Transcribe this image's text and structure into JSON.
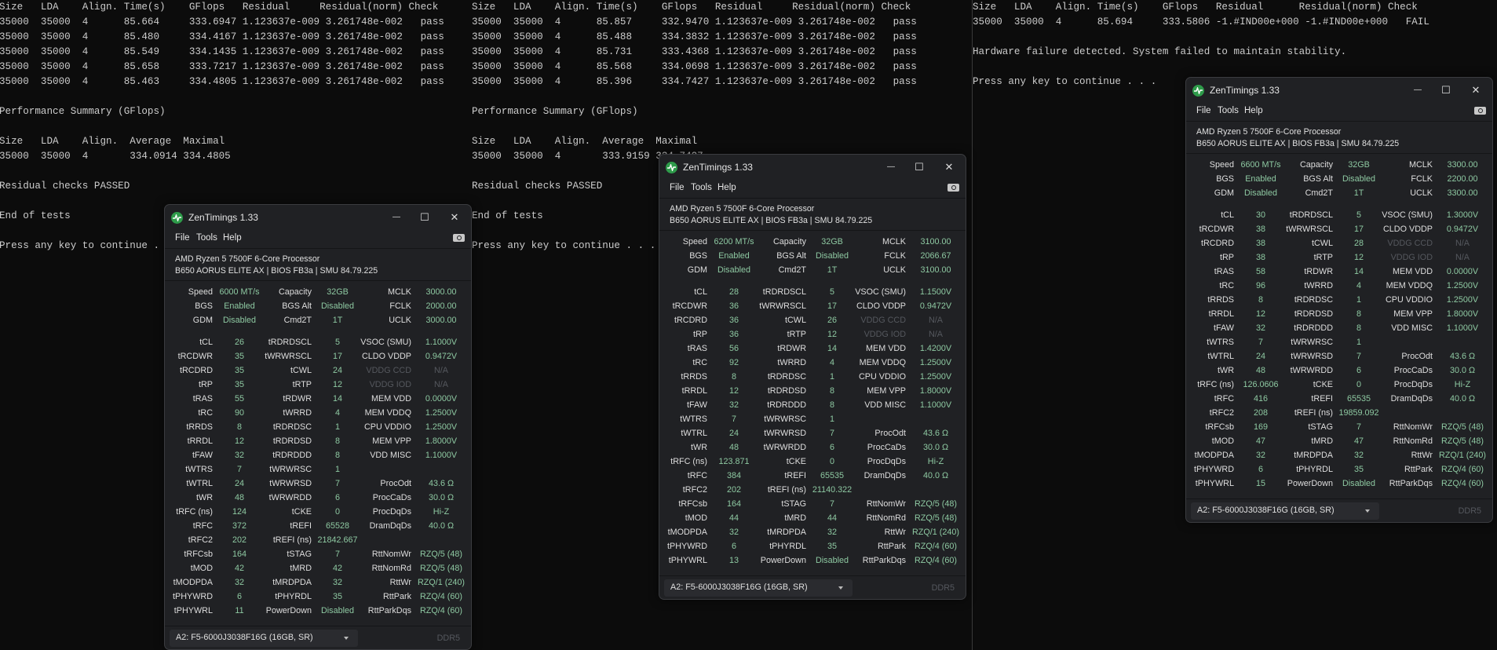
{
  "consoles": [
    {
      "lines": [
        "Size   LDA    Align. Time(s)    GFlops   Residual     Residual(norm) Check",
        "35000  35000  4      85.664     333.6947 1.123637e-009 3.261748e-002   pass",
        "35000  35000  4      85.480     334.4167 1.123637e-009 3.261748e-002   pass",
        "35000  35000  4      85.549     334.1435 1.123637e-009 3.261748e-002   pass",
        "35000  35000  4      85.658     333.7217 1.123637e-009 3.261748e-002   pass",
        "35000  35000  4      85.463     334.4805 1.123637e-009 3.261748e-002   pass",
        "",
        "Performance Summary (GFlops)",
        "",
        "Size   LDA    Align.  Average  Maximal",
        "35000  35000  4       334.0914 334.4805",
        "",
        "Residual checks PASSED",
        "",
        "End of tests",
        "",
        "Press any key to continue . . ."
      ]
    },
    {
      "lines": [
        "Size   LDA    Align. Time(s)    GFlops   Residual     Residual(norm) Check",
        "35000  35000  4      85.857     332.9470 1.123637e-009 3.261748e-002   pass",
        "35000  35000  4      85.488     334.3832 1.123637e-009 3.261748e-002   pass",
        "35000  35000  4      85.731     333.4368 1.123637e-009 3.261748e-002   pass",
        "35000  35000  4      85.568     334.0698 1.123637e-009 3.261748e-002   pass",
        "35000  35000  4      85.396     334.7427 1.123637e-009 3.261748e-002   pass",
        "",
        "Performance Summary (GFlops)",
        "",
        "Size   LDA    Align.  Average  Maximal",
        "35000  35000  4       333.9159 334.7427",
        "",
        "Residual checks PASSED",
        "",
        "End of tests",
        "",
        "Press any key to continue . . ."
      ]
    },
    {
      "lines": [
        "Size   LDA    Align. Time(s)    GFlops   Residual      Residual(norm) Check",
        "35000  35000  4      85.694     333.5806 -1.#IND00e+000 -1.#IND00e+000   FAIL",
        "",
        "Hardware failure detected. System failed to maintain stability.",
        "",
        "Press any key to continue . . ."
      ]
    }
  ],
  "zentimings": {
    "colors": {
      "background": "#202124",
      "value": "#8ec9a2",
      "label": "#dedede",
      "dimmed": "#55585e",
      "logo": "#2e9b4a"
    },
    "icons": {
      "logo": "pulse-icon",
      "minimize": "minimize-icon",
      "maximize": "maximize-icon",
      "close": "close-icon",
      "screenshot": "camera-icon",
      "dropdown": "chevron-down-icon"
    },
    "labels": {
      "top": [
        [
          "Speed",
          "Capacity",
          "MCLK"
        ],
        [
          "BGS",
          "BGS Alt",
          "FCLK"
        ],
        [
          "GDM",
          "Cmd2T",
          "UCLK"
        ]
      ],
      "rows": [
        [
          "tCL",
          "tRDRDSCL",
          "VSOC (SMU)"
        ],
        [
          "tRCDWR",
          "tWRWRSCL",
          "CLDO VDDP"
        ],
        [
          "tRCDRD",
          "tCWL",
          "VDDG CCD"
        ],
        [
          "tRP",
          "tRTP",
          "VDDG IOD"
        ],
        [
          "tRAS",
          "tRDWR",
          "MEM VDD"
        ],
        [
          "tRC",
          "tWRRD",
          "MEM VDDQ"
        ],
        [
          "tRRDS",
          "tRDRDSC",
          "CPU VDDIO"
        ],
        [
          "tRRDL",
          "tRDRDSD",
          "MEM VPP"
        ],
        [
          "tFAW",
          "tRDRDDD",
          "VDD MISC"
        ],
        [
          "tWTRS",
          "tWRWRSC",
          ""
        ],
        [
          "tWTRL",
          "tWRWRSD",
          "ProcOdt"
        ],
        [
          "tWR",
          "tWRWRDD",
          "ProcCaDs"
        ],
        [
          "tRFC (ns)",
          "tCKE",
          "ProcDqDs"
        ],
        [
          "tRFC",
          "tREFI",
          "DramDqDs"
        ],
        [
          "tRFC2",
          "tREFI (ns)",
          ""
        ],
        [
          "tRFCsb",
          "tSTAG",
          "RttNomWr"
        ],
        [
          "tMOD",
          "tMRD",
          "RttNomRd"
        ],
        [
          "tMODPDA",
          "tMRDPDA",
          "RttWr"
        ],
        [
          "tPHYWRD",
          "tPHYRDL",
          "RttPark"
        ],
        [
          "tPHYWRL",
          "PowerDown",
          "RttParkDqs"
        ]
      ]
    },
    "windows": [
      {
        "title": "ZenTimings 1.33",
        "menu": [
          "File",
          "Tools",
          "Help"
        ],
        "cpu": "AMD Ryzen 5 7500F 6-Core Processor",
        "board": "B650 AORUS ELITE AX | BIOS FB3a | SMU 84.79.225",
        "top": [
          [
            "6000 MT/s",
            "32GB",
            "3000.00"
          ],
          [
            "Enabled",
            "Disabled",
            "2000.00"
          ],
          [
            "Disabled",
            "1T",
            "3000.00"
          ]
        ],
        "rows": [
          [
            "26",
            "5",
            "1.1000V"
          ],
          [
            "35",
            "17",
            "0.9472V"
          ],
          [
            "35",
            "24",
            "N/A"
          ],
          [
            "35",
            "12",
            "N/A"
          ],
          [
            "55",
            "14",
            "0.0000V"
          ],
          [
            "90",
            "4",
            "1.2500V"
          ],
          [
            "8",
            "1",
            "1.2500V"
          ],
          [
            "12",
            "8",
            "1.8000V"
          ],
          [
            "32",
            "8",
            "1.1000V"
          ],
          [
            "7",
            "1",
            ""
          ],
          [
            "24",
            "7",
            "43.6 Ω"
          ],
          [
            "48",
            "6",
            "30.0 Ω"
          ],
          [
            "124",
            "0",
            "Hi-Z"
          ],
          [
            "372",
            "65528",
            "40.0 Ω"
          ],
          [
            "202",
            "21842.667",
            ""
          ],
          [
            "164",
            "7",
            "RZQ/5 (48)"
          ],
          [
            "42",
            "42",
            "RZQ/5 (48)"
          ],
          [
            "32",
            "32",
            "RZQ/1 (240)"
          ],
          [
            "6",
            "35",
            "RZQ/4 (60)"
          ],
          [
            "11",
            "Disabled",
            "RZQ/4 (60)"
          ]
        ],
        "dimm": "A2: F5-6000J3038F16G (16GB, SR)",
        "memtype": "DDR5"
      },
      {
        "title": "ZenTimings 1.33",
        "menu": [
          "File",
          "Tools",
          "Help"
        ],
        "cpu": "AMD Ryzen 5 7500F 6-Core Processor",
        "board": "B650 AORUS ELITE AX | BIOS FB3a | SMU 84.79.225",
        "top": [
          [
            "6200 MT/s",
            "32GB",
            "3100.00"
          ],
          [
            "Enabled",
            "Disabled",
            "2066.67"
          ],
          [
            "Disabled",
            "1T",
            "3100.00"
          ]
        ],
        "rows": [
          [
            "28",
            "5",
            "1.1500V"
          ],
          [
            "36",
            "17",
            "0.9472V"
          ],
          [
            "36",
            "26",
            "N/A"
          ],
          [
            "36",
            "12",
            "N/A"
          ],
          [
            "56",
            "14",
            "1.4200V"
          ],
          [
            "92",
            "4",
            "1.2500V"
          ],
          [
            "8",
            "1",
            "1.2500V"
          ],
          [
            "12",
            "8",
            "1.8000V"
          ],
          [
            "32",
            "8",
            "1.1000V"
          ],
          [
            "7",
            "1",
            ""
          ],
          [
            "24",
            "7",
            "43.6 Ω"
          ],
          [
            "48",
            "6",
            "30.0 Ω"
          ],
          [
            "123.871",
            "0",
            "Hi-Z"
          ],
          [
            "384",
            "65535",
            "40.0 Ω"
          ],
          [
            "202",
            "21140.322",
            ""
          ],
          [
            "164",
            "7",
            "RZQ/5 (48)"
          ],
          [
            "44",
            "44",
            "RZQ/5 (48)"
          ],
          [
            "32",
            "32",
            "RZQ/1 (240)"
          ],
          [
            "6",
            "35",
            "RZQ/4 (60)"
          ],
          [
            "13",
            "Disabled",
            "RZQ/4 (60)"
          ]
        ],
        "dimm": "A2: F5-6000J3038F16G (16GB, SR)",
        "memtype": "DDR5"
      },
      {
        "title": "ZenTimings 1.33",
        "menu": [
          "File",
          "Tools",
          "Help"
        ],
        "cpu": "AMD Ryzen 5 7500F 6-Core Processor",
        "board": "B650 AORUS ELITE AX | BIOS FB3a | SMU 84.79.225",
        "top": [
          [
            "6600 MT/s",
            "32GB",
            "3300.00"
          ],
          [
            "Enabled",
            "Disabled",
            "2200.00"
          ],
          [
            "Disabled",
            "1T",
            "3300.00"
          ]
        ],
        "rows": [
          [
            "30",
            "5",
            "1.3000V"
          ],
          [
            "38",
            "17",
            "0.9472V"
          ],
          [
            "38",
            "28",
            "N/A"
          ],
          [
            "38",
            "12",
            "N/A"
          ],
          [
            "58",
            "14",
            "0.0000V"
          ],
          [
            "96",
            "4",
            "1.2500V"
          ],
          [
            "8",
            "1",
            "1.2500V"
          ],
          [
            "12",
            "8",
            "1.8000V"
          ],
          [
            "32",
            "8",
            "1.1000V"
          ],
          [
            "7",
            "1",
            ""
          ],
          [
            "24",
            "7",
            "43.6 Ω"
          ],
          [
            "48",
            "6",
            "30.0 Ω"
          ],
          [
            "126.0606",
            "0",
            "Hi-Z"
          ],
          [
            "416",
            "65535",
            "40.0 Ω"
          ],
          [
            "208",
            "19859.092",
            ""
          ],
          [
            "169",
            "7",
            "RZQ/5 (48)"
          ],
          [
            "47",
            "47",
            "RZQ/5 (48)"
          ],
          [
            "32",
            "32",
            "RZQ/1 (240)"
          ],
          [
            "6",
            "35",
            "RZQ/4 (60)"
          ],
          [
            "15",
            "Disabled",
            "RZQ/4 (60)"
          ]
        ],
        "dimm": "A2: F5-6000J3038F16G (16GB, SR)",
        "memtype": "DDR5"
      }
    ]
  }
}
